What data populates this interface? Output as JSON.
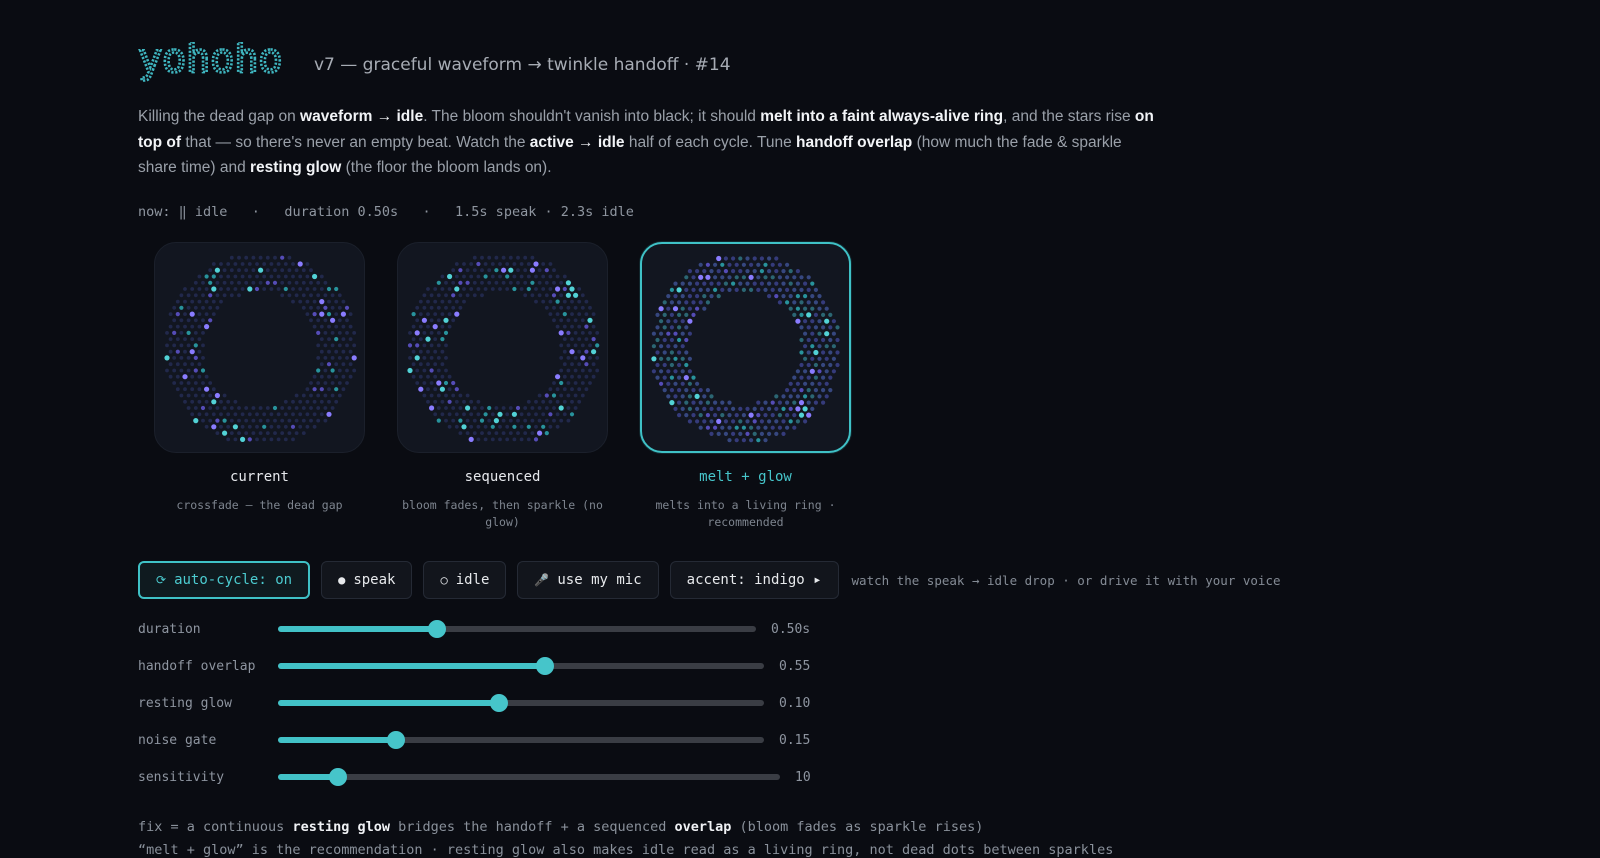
{
  "header": {
    "logo": "yohoho",
    "subtitle": "v7 — graceful waveform → twinkle handoff · #14"
  },
  "intro": {
    "t1": "Killing the dead gap on ",
    "b1": "waveform → idle",
    "t2": ". The bloom shouldn't vanish into black; it should ",
    "b2": "melt into a faint always-alive ring",
    "t3": ", and the stars rise ",
    "b3": "on top of",
    "t4": " that — so there's never an empty beat. Watch the ",
    "b4": "active → idle",
    "t5": " half of each cycle. Tune ",
    "b5": "handoff overlap",
    "t6": " (how much the fade & sparkle share time) and ",
    "b6": "resting glow",
    "t7": " (the floor the bloom lands on)."
  },
  "status": {
    "now": "now: ‖ idle",
    "duration": "duration 0.50s",
    "cycle": "1.5s speak · 2.3s idle",
    "sep": "·"
  },
  "cards": [
    {
      "title": "current",
      "desc": "crossfade — the dead gap",
      "selected": false
    },
    {
      "title": "sequenced",
      "desc": "bloom fades, then sparkle (no glow)",
      "selected": false
    },
    {
      "title": "melt + glow",
      "desc": "melts into a living ring · recommended",
      "selected": true
    }
  ],
  "controls": {
    "autocycle": {
      "icon": "⟳",
      "label": "auto-cycle: on"
    },
    "speak": {
      "icon": "●",
      "label": "speak"
    },
    "idle": {
      "icon": "○",
      "label": "idle"
    },
    "mic": {
      "icon": "🎤",
      "label": "use my mic"
    },
    "accent": {
      "label": "accent: indigo ▸"
    },
    "hint": "watch the speak → idle drop · or drive it with your voice"
  },
  "sliders": [
    {
      "label": "duration",
      "value": 0.5,
      "min": 0,
      "max": 1.5,
      "display": "0.50s"
    },
    {
      "label": "handoff overlap",
      "value": 0.55,
      "min": 0,
      "max": 1,
      "display": "0.55"
    },
    {
      "label": "resting glow",
      "value": 0.1,
      "min": 0,
      "max": 0.22,
      "display": "0.10"
    },
    {
      "label": "noise gate",
      "value": 0.15,
      "min": 0,
      "max": 0.62,
      "display": "0.15"
    },
    {
      "label": "sensitivity",
      "value": 10,
      "min": 0,
      "max": 84,
      "display": "10"
    }
  ],
  "footer": {
    "l1a": "fix = a continuous ",
    "l1b": "resting glow",
    "l1c": " bridges the handoff + a sequenced ",
    "l1d": "overlap",
    "l1e": " (bloom fades as sparkle rises)",
    "l2": "“melt + glow” is the recommendation · resting glow also makes idle read as a living ring, not dead dots between sparkles"
  },
  "colors": {
    "accent": "#42c2c7",
    "background": "#0a0c12",
    "dot_violet": "#7b6cf0",
    "dot_teal": "#3fbfc3"
  }
}
